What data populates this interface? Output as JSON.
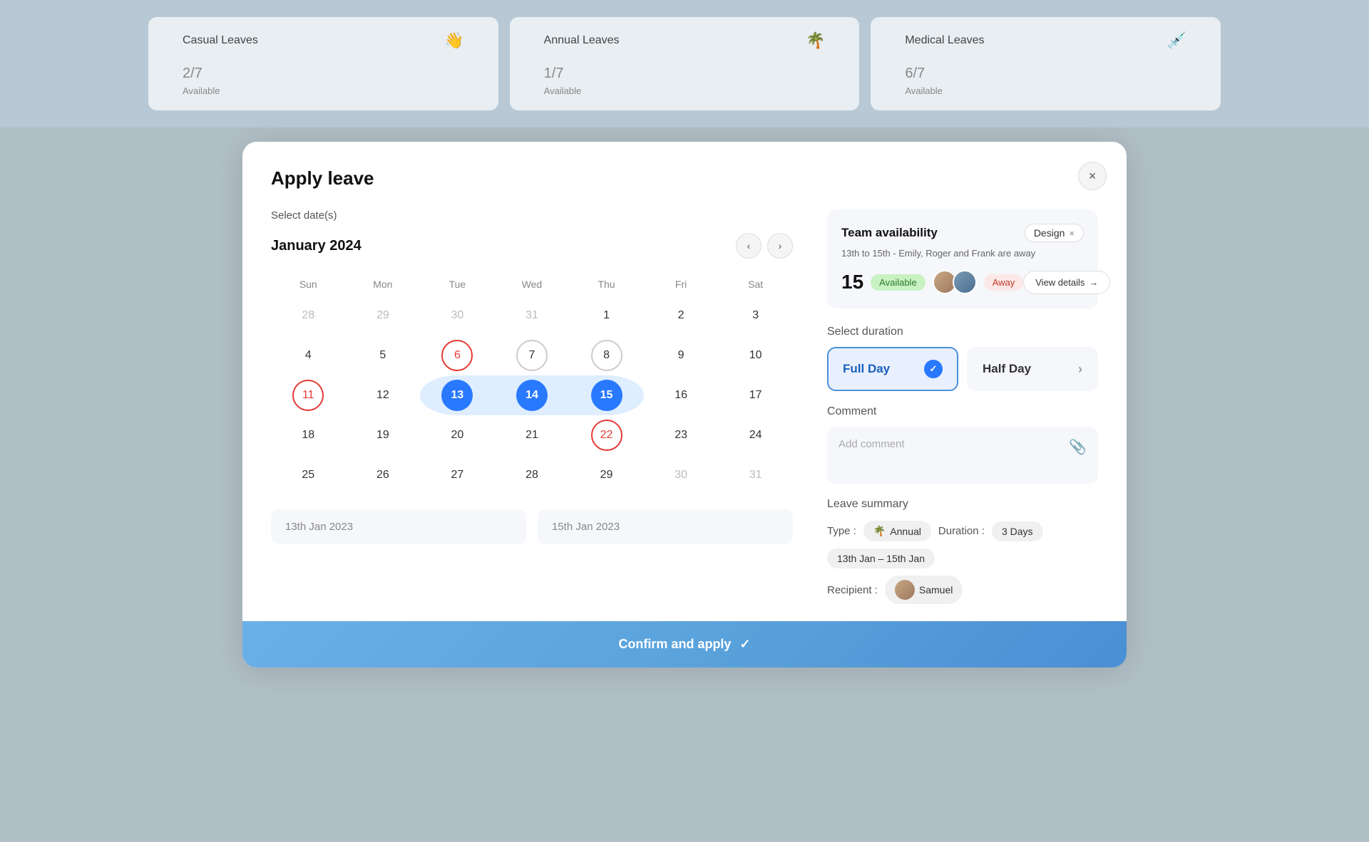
{
  "stats": {
    "cards": [
      {
        "title": "Casual Leaves",
        "icon": "👋",
        "number": "2",
        "denom": "/7",
        "available": "Available"
      },
      {
        "title": "Annual Leaves",
        "icon": "🌴",
        "number": "1",
        "denom": "/7",
        "available": "Available"
      },
      {
        "title": "Medical Leaves",
        "icon": "💉",
        "number": "6",
        "denom": "/7",
        "available": "Available"
      }
    ]
  },
  "modal": {
    "title": "Apply leave",
    "close_label": "×",
    "select_dates_label": "Select date(s)",
    "calendar": {
      "month": "January 2024",
      "weekdays": [
        "Sun",
        "Mon",
        "Tue",
        "Wed",
        "Thu",
        "Fri",
        "Sat"
      ],
      "weeks": [
        [
          {
            "day": "28",
            "type": "other"
          },
          {
            "day": "29",
            "type": "other"
          },
          {
            "day": "30",
            "type": "other"
          },
          {
            "day": "31",
            "type": "other"
          },
          {
            "day": "1",
            "type": "current"
          },
          {
            "day": "2",
            "type": "current"
          },
          {
            "day": "3",
            "type": "current"
          }
        ],
        [
          {
            "day": "4",
            "type": "current"
          },
          {
            "day": "5",
            "type": "current"
          },
          {
            "day": "6",
            "type": "current",
            "style": "ring-red"
          },
          {
            "day": "7",
            "type": "current",
            "style": "ring-gray"
          },
          {
            "day": "8",
            "type": "current",
            "style": "ring-gray"
          },
          {
            "day": "9",
            "type": "current"
          },
          {
            "day": "10",
            "type": "current"
          }
        ],
        [
          {
            "day": "11",
            "type": "current",
            "style": "ring-red"
          },
          {
            "day": "12",
            "type": "current"
          },
          {
            "day": "13",
            "type": "current",
            "style": "selected"
          },
          {
            "day": "14",
            "type": "current",
            "style": "selected"
          },
          {
            "day": "15",
            "type": "current",
            "style": "selected"
          },
          {
            "day": "16",
            "type": "current"
          },
          {
            "day": "17",
            "type": "current"
          }
        ],
        [
          {
            "day": "18",
            "type": "current"
          },
          {
            "day": "19",
            "type": "current"
          },
          {
            "day": "20",
            "type": "current"
          },
          {
            "day": "21",
            "type": "current"
          },
          {
            "day": "22",
            "type": "current",
            "style": "ring-red"
          },
          {
            "day": "23",
            "type": "current"
          },
          {
            "day": "24",
            "type": "current"
          }
        ],
        [
          {
            "day": "25",
            "type": "current"
          },
          {
            "day": "26",
            "type": "current"
          },
          {
            "day": "27",
            "type": "current"
          },
          {
            "day": "28",
            "type": "current"
          },
          {
            "day": "29",
            "type": "current"
          },
          {
            "day": "30",
            "type": "other"
          },
          {
            "day": "31",
            "type": "other"
          }
        ]
      ]
    },
    "date_start": "13th Jan 2023",
    "date_end": "15th Jan 2023",
    "team_availability": {
      "title": "Team availability",
      "tag": "Design",
      "subtitle": "13th to 15th - Emily, Roger and Frank are away",
      "count": "15",
      "badge_available": "Available",
      "badge_away": "Away",
      "view_details": "View details",
      "arrow": "→"
    },
    "select_duration": {
      "label": "Select duration",
      "full_day": "Full Day",
      "half_day": "Half Day"
    },
    "comment": {
      "label": "Comment",
      "placeholder": "Add comment"
    },
    "leave_summary": {
      "label": "Leave summary",
      "type_label": "Type :",
      "type_icon": "🌴",
      "type_value": "Annual",
      "duration_label": "Duration :",
      "duration_value": "3 Days",
      "date_range": "13th Jan – 15th Jan",
      "recipient_label": "Recipient :",
      "recipient_name": "Samuel"
    },
    "confirm_btn": "Confirm and apply",
    "confirm_check": "✓"
  }
}
